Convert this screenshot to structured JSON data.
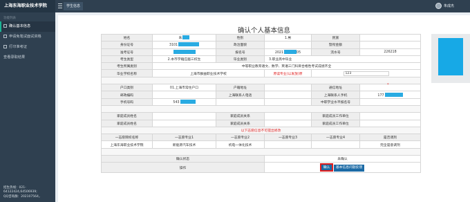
{
  "app": {
    "title": "上海东海职业技术学院",
    "top_tab": "学生信息",
    "user_name": "朱成杰"
  },
  "sidebar": {
    "header": "功能列表",
    "items": [
      {
        "label": "确认基本信息",
        "active": true
      },
      {
        "label": "申请免笔试面试资格",
        "active": false
      },
      {
        "label": "打印准考证",
        "active": false
      },
      {
        "label": "查看录取结果",
        "active": false
      }
    ],
    "contact": [
      "招生热线：021-",
      "64122424,64506939;",
      "QQ咨询群：202107564，"
    ]
  },
  "page": {
    "title": "确认个人基本信息"
  },
  "info": {
    "name_label": "姓名",
    "name_value": "朱",
    "gender_label": "性别",
    "gender_value": "1.男",
    "ethnic_label": "民族",
    "ethnic_value": "",
    "id_label": "身份证号",
    "id_value": "3101",
    "political_label": "政治面貌",
    "political_value": "",
    "points_label": "暨衔金额",
    "points_value": "",
    "exam_label": "准考证号",
    "exam_value": "",
    "reg_label": "报名号",
    "reg_value": "2021",
    "reg_value_tail": "05",
    "serial_label": "流水号",
    "serial_value": "226218",
    "type_label": "考生类型",
    "type_value": "2.本市学籍应届三校生",
    "grad_type_label": "毕业类别",
    "grad_type_value": "3.职业高中毕业",
    "exam_type_label": "考生所属类别",
    "exam_type_value": "中等职业教育语文、数学、英语三门科目合格性考试成绩齐全",
    "school_label": "毕业学校名称",
    "school_value": "上海市群益职业技术学校",
    "major_label": "原读专业(以发放)原",
    "major_value": "123",
    "hukou_label": "户口类别",
    "hukou_value": "01.上海市常住户口",
    "hukou_addr_label": "户籍地址",
    "hukou_addr_value": "",
    "mail_label": "通信地址",
    "mail_value": "",
    "postcode_label": "邮政编码",
    "postcode_value": "",
    "phone_label": "上海联系人电话",
    "phone_value": "",
    "mobile_label": "上海联系人手机",
    "mobile_value": "177",
    "cell_label": "手机号码",
    "cell_value": "543",
    "level_label": "中职学业水平报名号",
    "level_value": "",
    "family1_name_label": "家庭成员姓名",
    "family1_rel_label": "家庭成员关系",
    "family1_unit_label": "家庭成员工作单位",
    "family2_name_label": "家庭成员姓名",
    "family2_rel_label": "家庭成员关系",
    "family2_unit_label": "家庭成员工作单位",
    "notice": "以下志愿信息不可提出修改",
    "vol_headers": [
      "一志愿院校名称",
      "一志愿专业1",
      "一志愿专业2",
      "一志愿专业3",
      "一志愿专业4",
      "是否调剂"
    ],
    "vol_values": [
      "上海东海职业技术学院",
      "新能源汽车技术",
      "机电一体化技术",
      "",
      "",
      "完全是意调剂"
    ],
    "confirm_status_label": "确认状态",
    "confirm_status_value": "未确认",
    "action_label": "操作",
    "confirm_btn": "确认",
    "report_btn": "基本信息问题反馈"
  },
  "colors": {
    "sidebar": "#2f4050",
    "accent": "#1ab394",
    "mask": "#29abe2",
    "button": "#1b6aa5",
    "highlight": "#e01e1e"
  }
}
